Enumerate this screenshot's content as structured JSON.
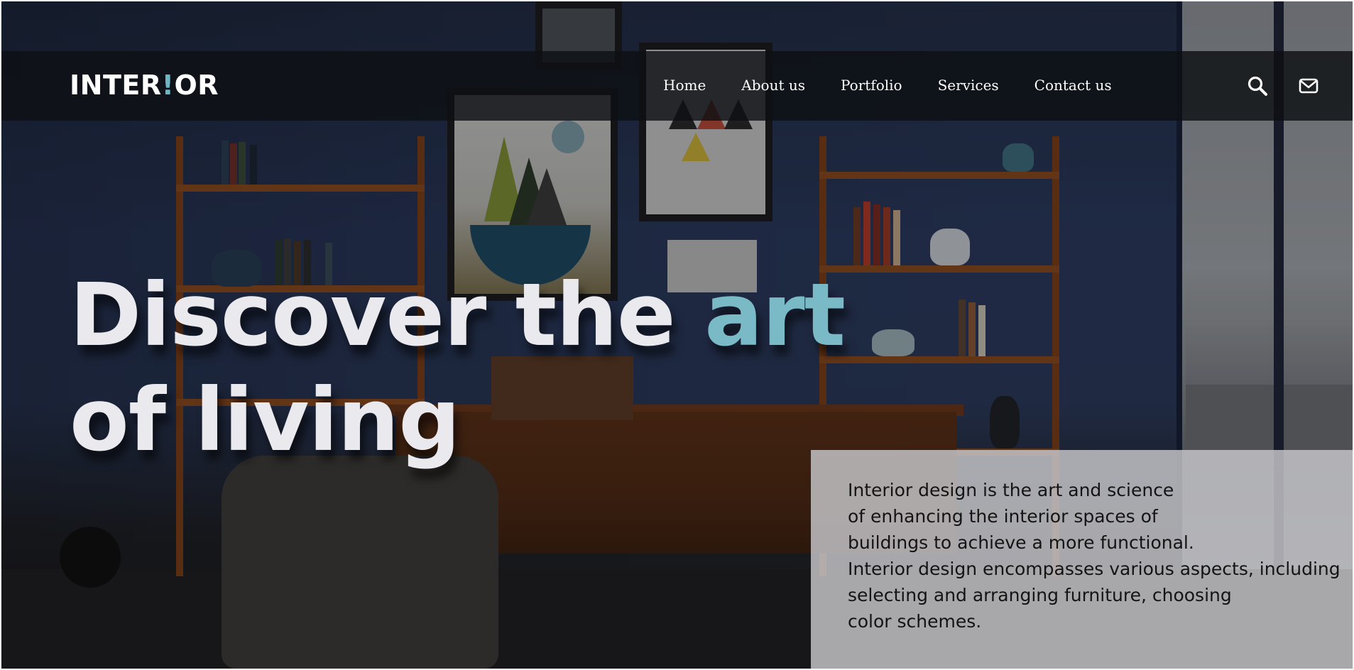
{
  "brand": {
    "logo_before": "INTER",
    "logo_mark": "!",
    "logo_after": "OR",
    "accent_color": "#6fb6c2"
  },
  "nav": {
    "items": [
      {
        "label": "Home"
      },
      {
        "label": "About us"
      },
      {
        "label": "Portfolio"
      },
      {
        "label": "Services"
      },
      {
        "label": "Contact us"
      }
    ],
    "icons": [
      "search-icon",
      "mail-icon"
    ]
  },
  "hero": {
    "headline_part1": "Discover the ",
    "headline_accent": "art",
    "headline_line2": "of living",
    "headline_color": "#e9e9ee",
    "accent_color": "#7ab9c6"
  },
  "description": {
    "lines": [
      "Interior design is the art and science",
      "of enhancing the interior spaces of",
      "buildings to achieve a more functional.",
      "Interior design encompasses various aspects, including",
      "selecting and arranging furniture, choosing",
      "color schemes."
    ]
  }
}
